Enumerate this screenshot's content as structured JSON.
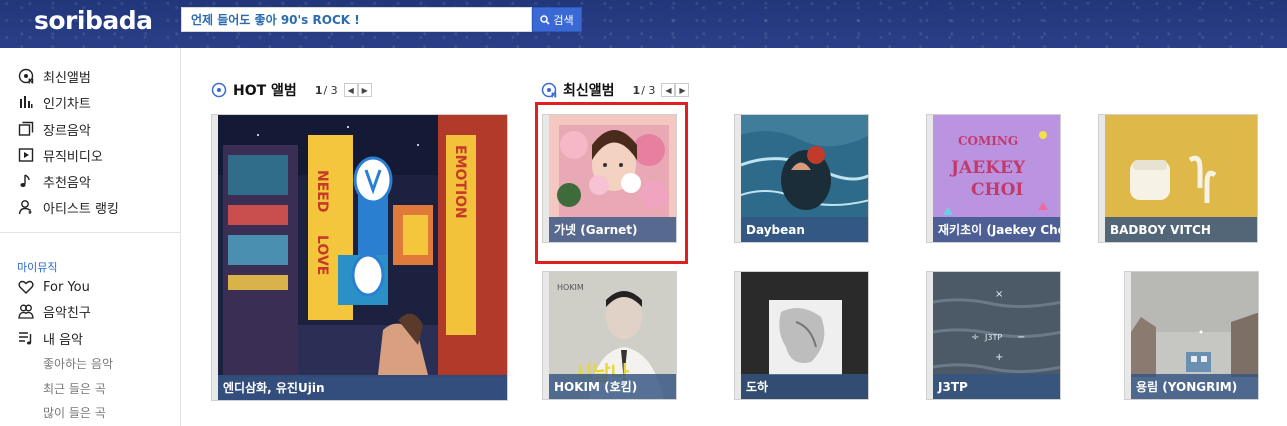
{
  "header": {
    "logo": "soribada",
    "search_value": "언제 들어도 좋아 90's ROCK !",
    "search_button": "검색"
  },
  "sidebar": {
    "items": [
      {
        "label": "최신앨범",
        "icon": "new-album-icon"
      },
      {
        "label": "인기차트",
        "icon": "chart-icon"
      },
      {
        "label": "장르음악",
        "icon": "genre-icon"
      },
      {
        "label": "뮤직비디오",
        "icon": "video-icon"
      },
      {
        "label": "추천음악",
        "icon": "music-note-icon"
      },
      {
        "label": "아티스트 랭킹",
        "icon": "artist-ranking-icon"
      }
    ],
    "my_music_title": "마이뮤직",
    "my_items": [
      {
        "label": "For You",
        "icon": "heart-icon"
      },
      {
        "label": "음악친구",
        "icon": "friends-icon"
      },
      {
        "label": "내 음악",
        "icon": "playlist-icon"
      }
    ],
    "sub_items": [
      "좋아하는 음악",
      "최근 들은 곡",
      "많이 들은 곡"
    ]
  },
  "hot": {
    "title": "HOT 앨범",
    "page_current": "1",
    "page_total": "/ 3",
    "album": {
      "caption": "엔디삼화, 유진Ujin"
    }
  },
  "new": {
    "title": "최신앨범",
    "page_current": "1",
    "page_total": "/ 3",
    "albums": [
      {
        "caption": "가넷 (Garnet)"
      },
      {
        "caption": "Daybean"
      },
      {
        "caption": "재키초이 (Jaekey Choi)"
      },
      {
        "caption": "BADBOY VITCH"
      },
      {
        "caption": "HOKIM (호킴)"
      },
      {
        "caption": "도하"
      },
      {
        "caption": "J3TP"
      },
      {
        "caption": "용림 (YONGRIM)"
      }
    ]
  },
  "colors": {
    "header_bg": "#27397f",
    "accent_blue": "#3a69d6",
    "caption_bg": "#345482",
    "highlight_red": "#e02020"
  },
  "artwork_text": {
    "hot_neon_1": "NEED",
    "hot_neon_2": "LOVE",
    "hot_neon_3": "EMOTION",
    "jaekey_1": "COMING",
    "jaekey_2": "JAEKEY",
    "jaekey_3": "CHOI",
    "hokim_top": "HOKIM",
    "hokim_script": "시날나",
    "j3tp_mark": "J3TP"
  }
}
